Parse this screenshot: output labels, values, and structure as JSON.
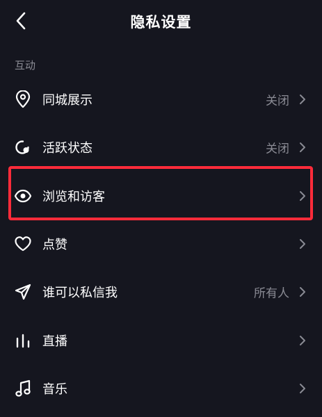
{
  "header": {
    "title": "隐私设置"
  },
  "section": {
    "label": "互动"
  },
  "rows": [
    {
      "label": "同城展示",
      "value": "关闭",
      "icon": "location-pin-icon"
    },
    {
      "label": "活跃状态",
      "value": "关闭",
      "icon": "activity-status-icon"
    },
    {
      "label": "浏览和访客",
      "value": "",
      "icon": "eye-icon"
    },
    {
      "label": "点赞",
      "value": "",
      "icon": "heart-icon"
    },
    {
      "label": "谁可以私信我",
      "value": "所有人",
      "icon": "send-icon"
    },
    {
      "label": "直播",
      "value": "",
      "icon": "bar-chart-icon"
    },
    {
      "label": "音乐",
      "value": "",
      "icon": "music-note-icon"
    }
  ],
  "colors": {
    "background": "#15161f",
    "text": "#ffffff",
    "secondary_text": "#8a8b94",
    "highlight_border": "#ff2b3a"
  }
}
